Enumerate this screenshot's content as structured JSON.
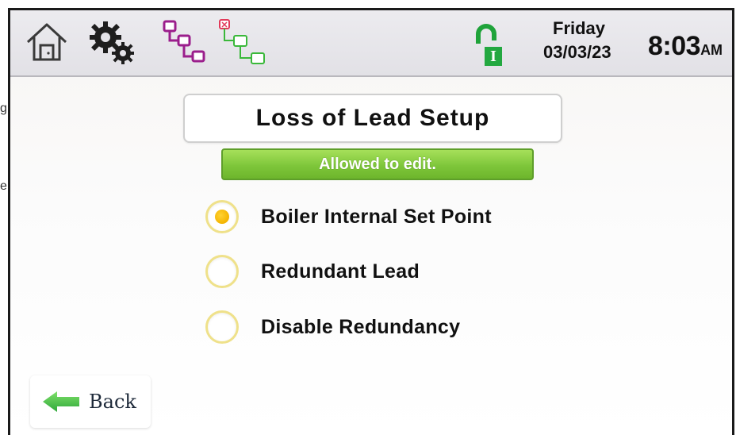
{
  "stray_text": {
    "left_top": "g",
    "left_bottom": "e"
  },
  "header": {
    "icons": [
      "home-icon",
      "gear-icon",
      "network-purple-icon",
      "network-green-icon",
      "lock-unlocked-icon"
    ],
    "lock_badge": "I",
    "date_day": "Friday",
    "date_value": "03/03/23",
    "time_value": "8:03",
    "time_ampm": "AM"
  },
  "page_title": "Loss of Lead Setup",
  "edit_status": "Allowed to edit.",
  "options": [
    {
      "label": "Boiler Internal Set Point",
      "selected": true
    },
    {
      "label": "Redundant Lead",
      "selected": false
    },
    {
      "label": "Disable Redundancy",
      "selected": false
    }
  ],
  "back_button": {
    "label": "Back",
    "icon": "arrow-left-icon"
  },
  "colors": {
    "accent_green": "#7ec63a",
    "radio_selected": "#f4b400",
    "radio_border": "#efe18a",
    "network_purple": "#9b1e8c",
    "network_green": "#3ab83a",
    "network_red": "#e23a5a"
  }
}
